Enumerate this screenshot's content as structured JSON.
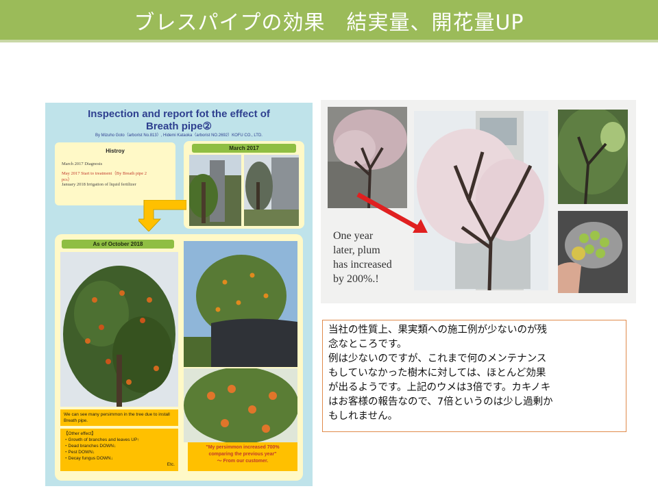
{
  "slide": {
    "title": "ブレスパイプの効果　結実量、開花量UP"
  },
  "poster": {
    "title_line1": "Inspection and report fot the effect of",
    "title_line2": "Breath pipe②",
    "byline": "By Mizuho Goto（arborist No.813）, Hidemi Kataoka（arborist NO.2692）KOFU CO., LTD.",
    "history_title": "Histroy",
    "history_lines": [
      "March 2017  Diagnosis",
      "May 2017   Start to treatment（By Breath pipe 2",
      "pcs）",
      "January 2018 Irrigation of liquid fertilizer"
    ],
    "march_label": "March 2017",
    "october_label": "As of October 2018",
    "note_left": "We can see many persimmon in the tree due to install Breath pipe.",
    "other_effect_title": "【Other effect】",
    "other_effects": [
      "・Growth of branches and leaves UP↑",
      "・Dead branches  DOWN↓",
      "・Pest  DOWN↓",
      "・Decay fungus DOWN↓"
    ],
    "etc": "Etc.",
    "quote_part1": "\"My persimmon increased ",
    "quote_highlight": "700%",
    "quote_part2": "comparing the previous year\"",
    "quote_from": "～ From  our customer."
  },
  "photo_panel": {
    "caption_lines": [
      "One year",
      "later, plum",
      "has increased",
      "by 200%.!"
    ]
  },
  "comment_box": {
    "lines": [
      "当社の性質上、果実類への施工例が少ないのが残",
      "念なところです。",
      "例は少ないのですが、これまで何のメンテナンス",
      "もしていなかった樹木に対しては、ほとんど効果",
      "が出るようです。上記のウメは3倍です。カキノキ",
      "はお客様の報告なので、7倍というのは少し過剰か",
      "もしれません。"
    ]
  },
  "colors": {
    "title_bar": "#9bbb59",
    "poster_bg": "#bfe3ea",
    "panel_box": "#fff9c7",
    "label_green": "#8fbe43",
    "note_orange": "#ffc000",
    "arrow_red": "#e02020",
    "box_border": "#e08a4a"
  },
  "icons": {
    "down_arrow": "down-arrow-icon",
    "red_pointer": "red-pointer-arrow-icon"
  }
}
